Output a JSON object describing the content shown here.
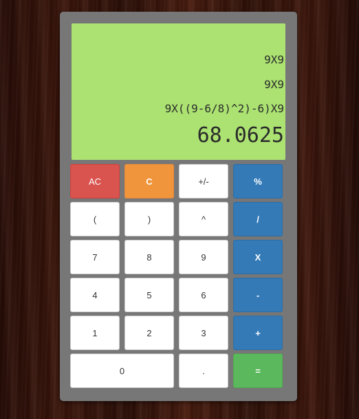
{
  "display": {
    "history": [
      "9X9",
      "9X9",
      "9X((9-6/8)^2)-6)X9"
    ],
    "result": "68.0625"
  },
  "buttons": {
    "ac": "AC",
    "c": "C",
    "plus_minus": "+/-",
    "percent": "%",
    "open_paren": "(",
    "close_paren": ")",
    "power": "^",
    "divide": "/",
    "seven": "7",
    "eight": "8",
    "nine": "9",
    "multiply": "X",
    "four": "4",
    "five": "5",
    "six": "6",
    "minus": "-",
    "one": "1",
    "two": "2",
    "three": "3",
    "plus": "+",
    "zero": "0",
    "decimal": ".",
    "equals": "="
  },
  "colors": {
    "display_bg": "#abe271",
    "body_bg": "#777777",
    "clear_all": "#d9534f",
    "clear": "#f0953b",
    "operator": "#337ab7",
    "equals": "#5cb85c"
  }
}
